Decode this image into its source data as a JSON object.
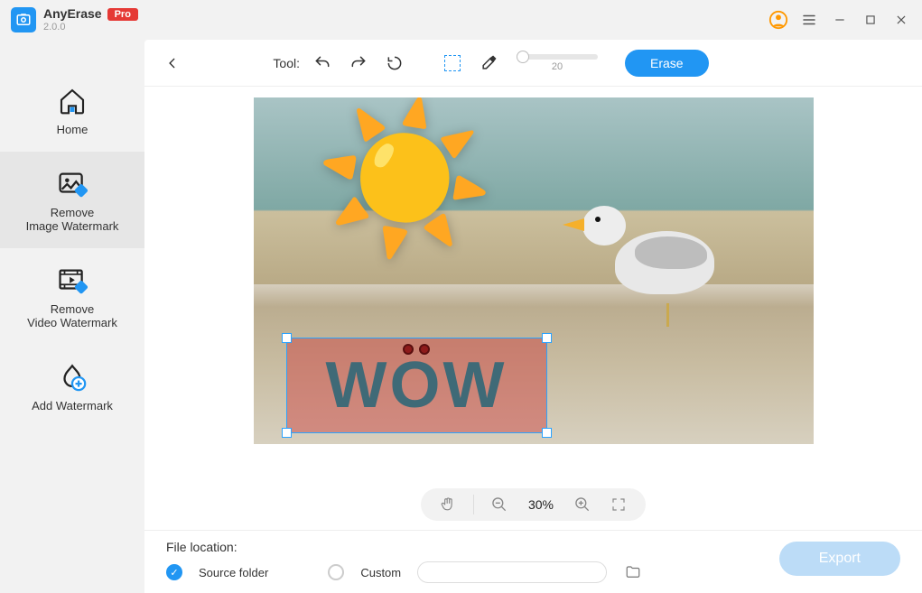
{
  "app": {
    "name": "AnyErase",
    "version": "2.0.0",
    "badge": "Pro"
  },
  "sidebar": {
    "items": [
      {
        "label": "Home"
      },
      {
        "label": "Remove\nImage Watermark"
      },
      {
        "label": "Remove\nVideo Watermark"
      },
      {
        "label": "Add Watermark"
      }
    ]
  },
  "toolbar": {
    "tool_label": "Tool:",
    "slider_value": "20",
    "erase_label": "Erase"
  },
  "canvas": {
    "overlay_text": "WOW"
  },
  "zoom": {
    "value": "30%"
  },
  "footer": {
    "location_label": "File location:",
    "source_label": "Source folder",
    "custom_label": "Custom",
    "export_label": "Export"
  }
}
